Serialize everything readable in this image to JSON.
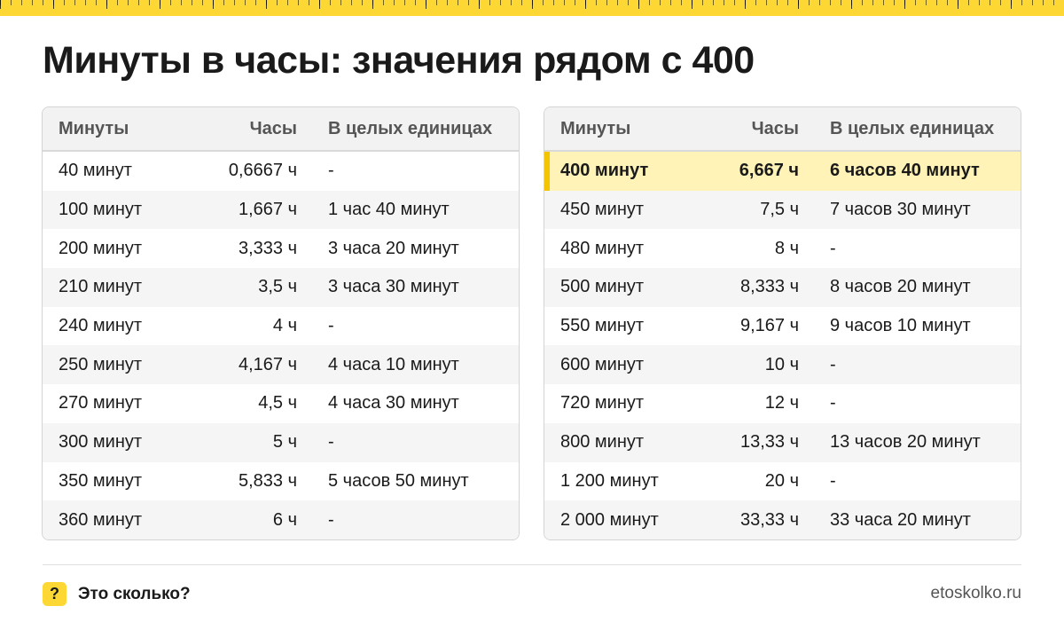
{
  "title": "Минуты в часы: значения рядом с 400",
  "columns": [
    "Минуты",
    "Часы",
    "В целых единицах"
  ],
  "left_rows": [
    [
      "40 минут",
      "0,6667 ч",
      "-"
    ],
    [
      "100 минут",
      "1,667 ч",
      "1 час 40 минут"
    ],
    [
      "200 минут",
      "3,333 ч",
      "3 часа 20 минут"
    ],
    [
      "210 минут",
      "3,5 ч",
      "3 часа 30 минут"
    ],
    [
      "240 минут",
      "4 ч",
      "-"
    ],
    [
      "250 минут",
      "4,167 ч",
      "4 часа 10 минут"
    ],
    [
      "270 минут",
      "4,5 ч",
      "4 часа 30 минут"
    ],
    [
      "300 минут",
      "5 ч",
      "-"
    ],
    [
      "350 минут",
      "5,833 ч",
      "5 часов 50 минут"
    ],
    [
      "360 минут",
      "6 ч",
      "-"
    ]
  ],
  "right_rows": [
    [
      "400 минут",
      "6,667 ч",
      "6 часов 40 минут"
    ],
    [
      "450 минут",
      "7,5 ч",
      "7 часов 30 минут"
    ],
    [
      "480 минут",
      "8 ч",
      "-"
    ],
    [
      "500 минут",
      "8,333 ч",
      "8 часов 20 минут"
    ],
    [
      "550 минут",
      "9,167 ч",
      "9 часов 10 минут"
    ],
    [
      "600 минут",
      "10 ч",
      "-"
    ],
    [
      "720 минут",
      "12 ч",
      "-"
    ],
    [
      "800 минут",
      "13,33 ч",
      "13 часов 20 минут"
    ],
    [
      "1 200 минут",
      "20 ч",
      "-"
    ],
    [
      "2 000 минут",
      "33,33 ч",
      "33 часа 20 минут"
    ]
  ],
  "highlighted_row": "400 минут",
  "footer": {
    "logo_glyph": "?",
    "brand": "Это сколько?",
    "site": "etoskolko.ru"
  },
  "colors": {
    "accent": "#fdd835",
    "highlight_bg": "#fff3b8",
    "highlight_bar": "#f5c400"
  }
}
